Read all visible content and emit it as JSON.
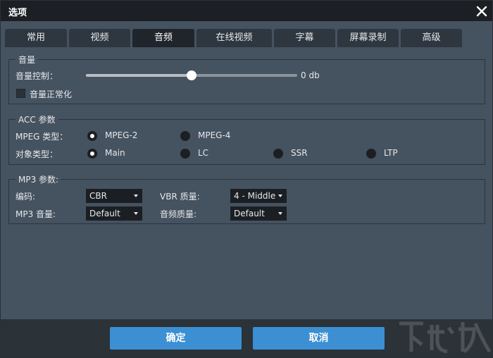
{
  "window": {
    "title": "选项"
  },
  "tabs": [
    {
      "label": "常用"
    },
    {
      "label": "视频"
    },
    {
      "label": "音频"
    },
    {
      "label": "在线视频"
    },
    {
      "label": "字幕"
    },
    {
      "label": "屏幕录制"
    },
    {
      "label": "高级"
    }
  ],
  "active_tab": "音频",
  "volume": {
    "title": "音量",
    "control_label": "音量控制：",
    "value_text": "0 db",
    "slider_fraction": 0.5,
    "normalize_label": "音量正常化",
    "normalize_checked": false
  },
  "acc": {
    "title": "ACC 参数",
    "mpeg_label": "MPEG 类型：",
    "mpeg_options": [
      "MPEG-2",
      "MPEG-4"
    ],
    "mpeg_selected": "MPEG-2",
    "object_label": "对象类型：",
    "object_options": [
      "Main",
      "LC",
      "SSR",
      "LTP"
    ],
    "object_selected": "Main"
  },
  "mp3": {
    "title": "MP3 参数:",
    "encoding_label": "编码:",
    "encoding_value": "CBR",
    "vbr_label": "VBR 质量:",
    "vbr_value": "4 - Middle",
    "volume_label": "MP3 音量:",
    "volume_value": "Default",
    "audio_quality_label": "音频质量:",
    "audio_quality_value": "Default"
  },
  "buttons": {
    "ok": "确定",
    "cancel": "取消"
  },
  "colors": {
    "accent": "#3c8fd3",
    "panel": "#455260",
    "titlebar": "#1c2024",
    "tab_active": "#1f252b"
  }
}
